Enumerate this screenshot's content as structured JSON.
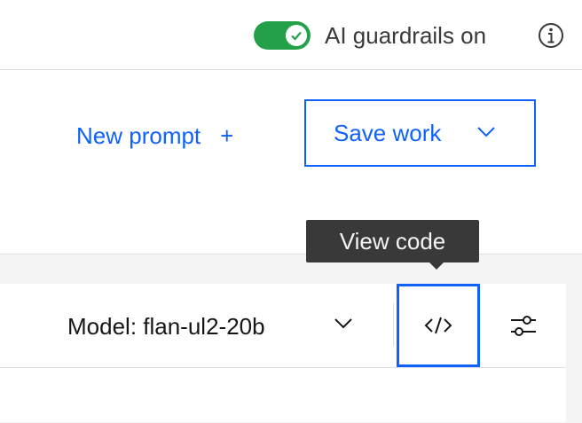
{
  "header": {
    "guardrails": {
      "label": "AI guardrails on",
      "enabled": true,
      "color": "#24a148"
    },
    "info_icon": "info-icon"
  },
  "actions": {
    "new_prompt_label": "New prompt",
    "new_prompt_icon": "+",
    "save_work_label": "Save work"
  },
  "model_bar": {
    "model_label": "Model: flan-ul2-20b",
    "code_icon": "</>",
    "settings_icon": "sliders-icon"
  },
  "tooltip": {
    "text": "View code"
  },
  "colors": {
    "accent": "#0f62fe",
    "tooltip_bg": "#393939",
    "panel_bg": "#f4f4f4"
  }
}
